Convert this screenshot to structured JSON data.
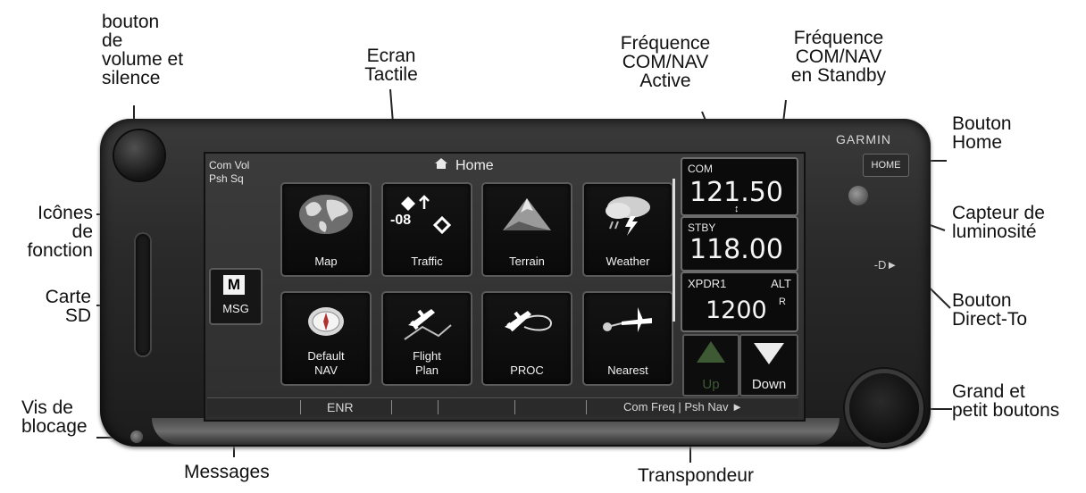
{
  "callouts": {
    "volume": "bouton\nde\nvolume et\nsilence",
    "ecran": "Ecran\nTactile",
    "freq_active": "Fréquence\nCOM/NAV\nActive",
    "freq_standby": "Fréquence\nCOM/NAV\nen Standby",
    "home": "Bouton\nHome",
    "capteur": "Capteur de\nluminosité",
    "icones": "Icônes\nde\nfonction",
    "carte_sd": "Carte\nSD",
    "direct_to": "Bouton\nDirect-To",
    "grand_petit": "Grand et\npetit boutons",
    "vis": "Vis de\nblocage",
    "messages": "Messages",
    "transpondeur": "Transpondeur"
  },
  "device": {
    "brand": "GARMIN",
    "home_button": "HOME",
    "direct_to_button": "-D►"
  },
  "screen": {
    "com_vol": "Com Vol\nPsh Sq",
    "title": "Home",
    "msg_button": "MSG",
    "tiles": [
      {
        "label": "Map",
        "icon": "globe-icon"
      },
      {
        "label": "Traffic",
        "icon": "traffic-icon",
        "value": "-08"
      },
      {
        "label": "Terrain",
        "icon": "terrain-icon"
      },
      {
        "label": "Weather",
        "icon": "weather-icon"
      },
      {
        "label": "Default\nNAV",
        "icon": "compass-icon"
      },
      {
        "label": "Flight\nPlan",
        "icon": "flight-plan-icon"
      },
      {
        "label": "PROC",
        "icon": "procedure-icon"
      },
      {
        "label": "Nearest",
        "icon": "nearest-icon"
      }
    ],
    "com": {
      "label": "COM",
      "active": "121.50"
    },
    "stby": {
      "label": "STBY",
      "value": "118.00"
    },
    "xpdr": {
      "label": "XPDR1",
      "mode": "ALT",
      "code": "1200",
      "suffix": "R"
    },
    "up_button": "Up",
    "down_button": "Down",
    "softkeys": {
      "left": "ENR",
      "right": "Com Freq | Psh Nav ►"
    }
  },
  "colors": {
    "screen_bg": "#2e2e2e",
    "tile_bg": "#0a0a0a",
    "up_dim": "#3d5a35"
  }
}
